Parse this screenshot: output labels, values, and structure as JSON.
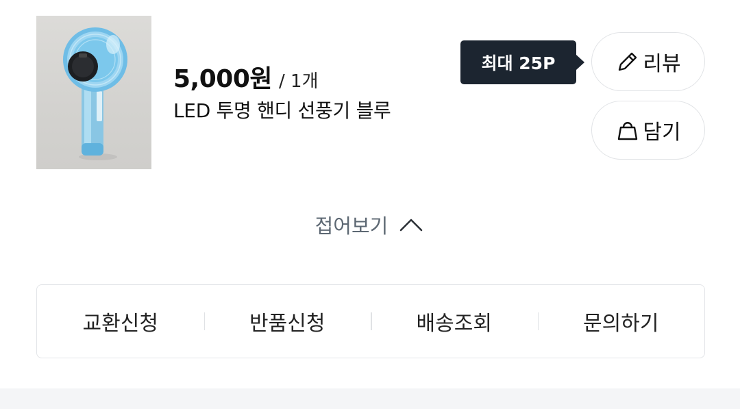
{
  "product": {
    "price": "5,000원",
    "quantity": "/ 1개",
    "name": "LED 투명 핸디 선풍기 블루",
    "image_icon": "handheld-fan-image"
  },
  "tooltip": {
    "text": "최대 25P"
  },
  "buttons": {
    "review_label": "리뷰",
    "review_icon": "pencil-icon",
    "cart_label": "담기",
    "cart_icon": "shopping-bag-icon"
  },
  "collapse": {
    "label": "접어보기",
    "icon": "chevron-up-icon"
  },
  "actions": [
    {
      "label": "교환신청"
    },
    {
      "label": "반품신청"
    },
    {
      "label": "배송조회"
    },
    {
      "label": "문의하기"
    }
  ],
  "colors": {
    "tooltip_bg": "#1c2530",
    "collapse_text": "#5d6873",
    "border": "#e1e3e6",
    "bottom_band": "#f4f5f7"
  }
}
